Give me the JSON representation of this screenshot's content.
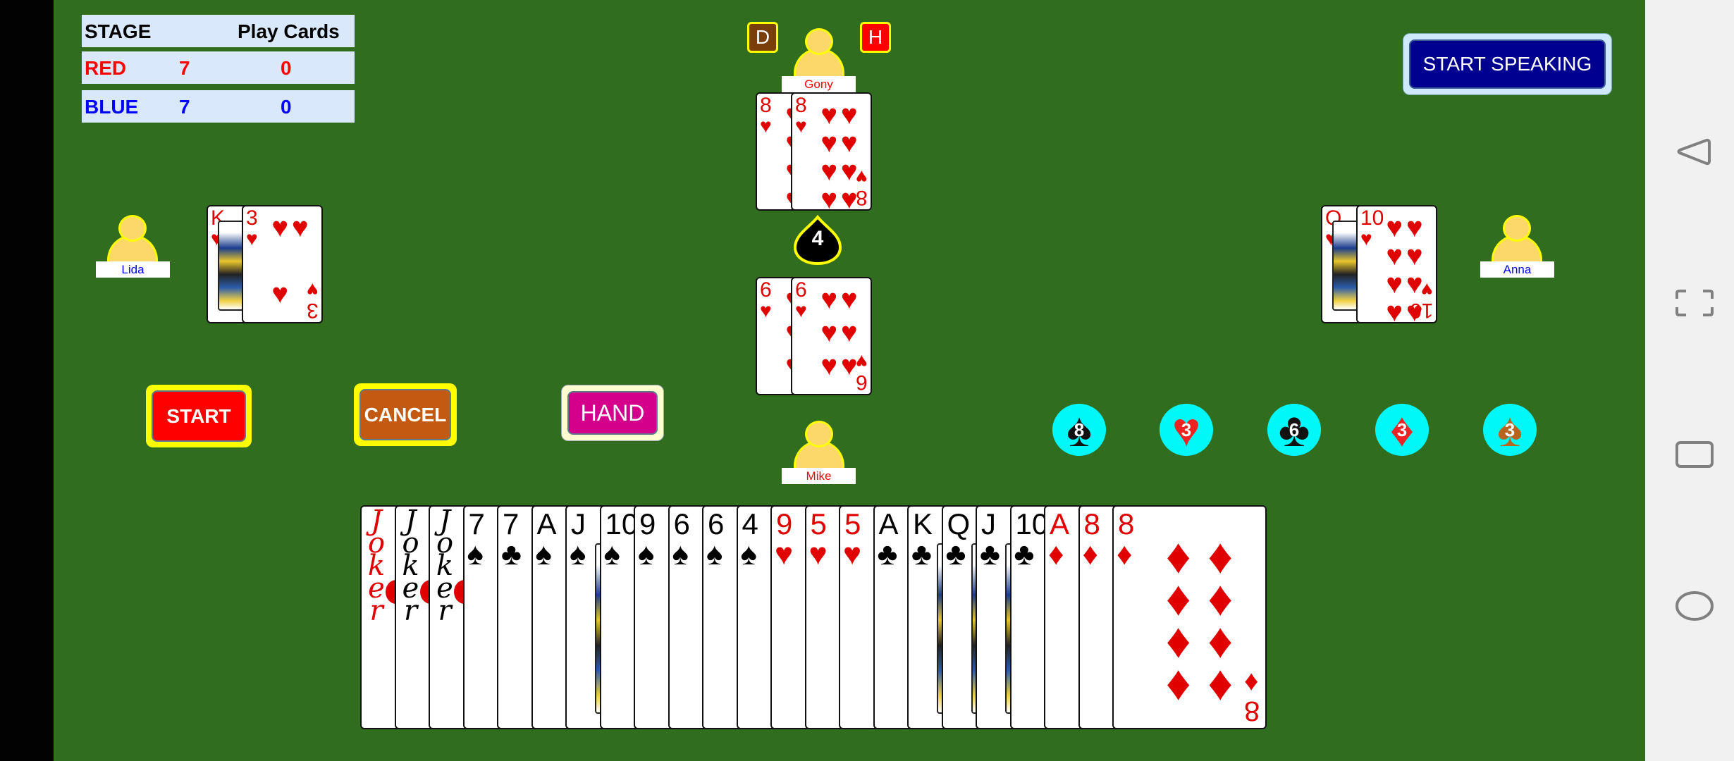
{
  "scoreboard": {
    "header_left": "STAGE",
    "header_right": "Play Cards",
    "teams": [
      {
        "name": "RED",
        "score": "7",
        "cards": "0",
        "color": "#ff0000"
      },
      {
        "name": "BLUE",
        "score": "7",
        "cards": "0",
        "color": "#0000ff"
      }
    ]
  },
  "players": {
    "top": {
      "name": "Gony",
      "name_color": "#ff0000"
    },
    "left": {
      "name": "Lida",
      "name_color": "#0000ff"
    },
    "right": {
      "name": "Anna",
      "name_color": "#0000ff"
    },
    "bottom": {
      "name": "Mike",
      "name_color": "#ff0000"
    }
  },
  "badges": {
    "dealer": {
      "label": "D",
      "color": "#7a3e0a"
    },
    "hand": {
      "label": "H",
      "color": "#ff0000"
    }
  },
  "trick_counter": "4",
  "played_cards": {
    "top": [
      {
        "rank": "8",
        "suit": "♥"
      },
      {
        "rank": "8",
        "suit": "♥"
      }
    ],
    "left": [
      {
        "rank": "K",
        "suit": "♥"
      },
      {
        "rank": "3",
        "suit": "♥"
      }
    ],
    "right": [
      {
        "rank": "Q",
        "suit": "♥"
      },
      {
        "rank": "10",
        "suit": "♥"
      }
    ],
    "bottom": [
      {
        "rank": "6",
        "suit": "♥"
      },
      {
        "rank": "6",
        "suit": "♥"
      }
    ]
  },
  "buttons": {
    "start_speaking": "START SPEAKING",
    "start": "START",
    "cancel": "CANCEL",
    "hand": "HAND"
  },
  "suit_counts": [
    {
      "suit": "spades",
      "glyph": "♠",
      "count": "8"
    },
    {
      "suit": "hearts",
      "glyph": "♥",
      "count": "3"
    },
    {
      "suit": "clubs",
      "glyph": "♣",
      "count": "6"
    },
    {
      "suit": "diamonds",
      "glyph": "♦",
      "count": "3"
    },
    {
      "suit": "trump-spade",
      "glyph": "♠",
      "count": "3"
    }
  ],
  "hand": [
    {
      "rank": "Joker",
      "suit": "",
      "color": "red"
    },
    {
      "rank": "Joker",
      "suit": "",
      "color": "black"
    },
    {
      "rank": "Joker",
      "suit": "",
      "color": "black"
    },
    {
      "rank": "7",
      "suit": "♠",
      "color": "black"
    },
    {
      "rank": "7",
      "suit": "♣",
      "color": "black"
    },
    {
      "rank": "A",
      "suit": "♠",
      "color": "black"
    },
    {
      "rank": "J",
      "suit": "♠",
      "color": "black"
    },
    {
      "rank": "10",
      "suit": "♠",
      "color": "black"
    },
    {
      "rank": "9",
      "suit": "♠",
      "color": "black"
    },
    {
      "rank": "6",
      "suit": "♠",
      "color": "black"
    },
    {
      "rank": "6",
      "suit": "♠",
      "color": "black"
    },
    {
      "rank": "4",
      "suit": "♠",
      "color": "black"
    },
    {
      "rank": "9",
      "suit": "♥",
      "color": "red"
    },
    {
      "rank": "5",
      "suit": "♥",
      "color": "red"
    },
    {
      "rank": "5",
      "suit": "♥",
      "color": "red"
    },
    {
      "rank": "A",
      "suit": "♣",
      "color": "black"
    },
    {
      "rank": "K",
      "suit": "♣",
      "color": "black"
    },
    {
      "rank": "Q",
      "suit": "♣",
      "color": "black"
    },
    {
      "rank": "J",
      "suit": "♣",
      "color": "black"
    },
    {
      "rank": "10",
      "suit": "♣",
      "color": "black"
    },
    {
      "rank": "A",
      "suit": "♦",
      "color": "red"
    },
    {
      "rank": "8",
      "suit": "♦",
      "color": "red"
    },
    {
      "rank": "8",
      "suit": "♦",
      "color": "red"
    }
  ],
  "nav": {
    "back": "back-icon",
    "screenshot": "fullscreen-icon",
    "recents": "recents-icon",
    "home": "home-icon"
  }
}
